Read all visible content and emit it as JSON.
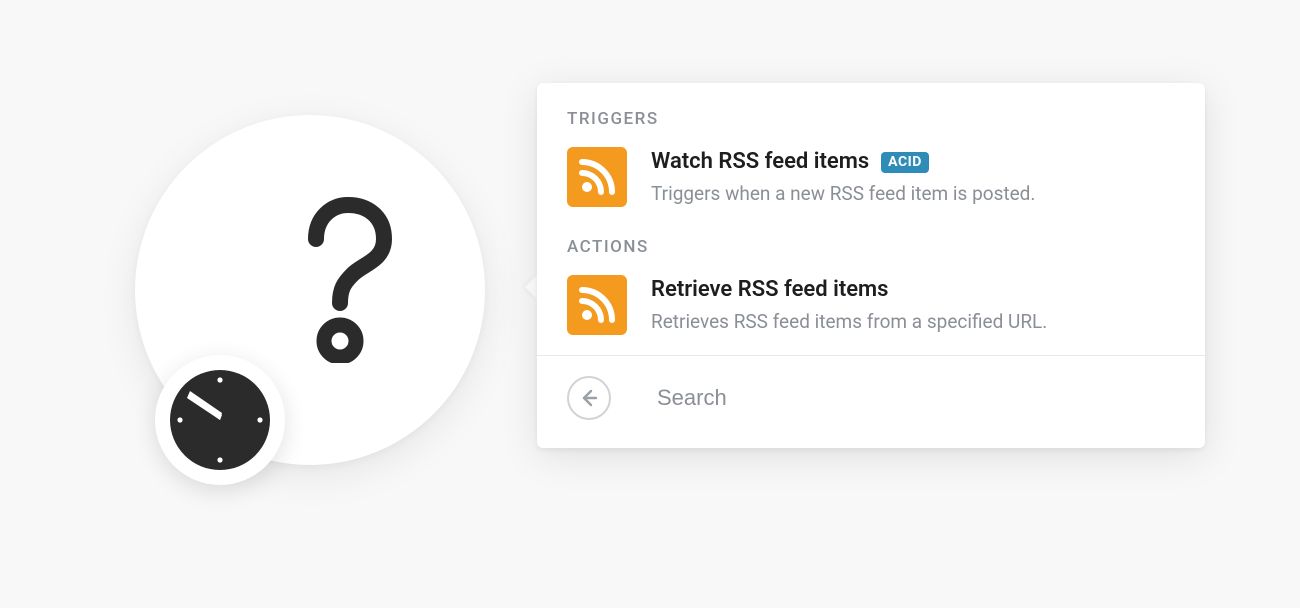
{
  "sections": {
    "triggers": {
      "label": "TRIGGERS",
      "items": [
        {
          "title": "Watch RSS feed items",
          "desc": "Triggers when a new RSS feed item is posted.",
          "badge": "ACID"
        }
      ]
    },
    "actions": {
      "label": "ACTIONS",
      "items": [
        {
          "title": "Retrieve RSS feed items",
          "desc": "Retrieves RSS feed items from a specified URL."
        }
      ]
    }
  },
  "search": {
    "placeholder": "Search"
  },
  "colors": {
    "rss_icon_bg": "#f39a1f",
    "badge_bg": "#2f8bb8",
    "node_icon": "#2b2b2b"
  }
}
